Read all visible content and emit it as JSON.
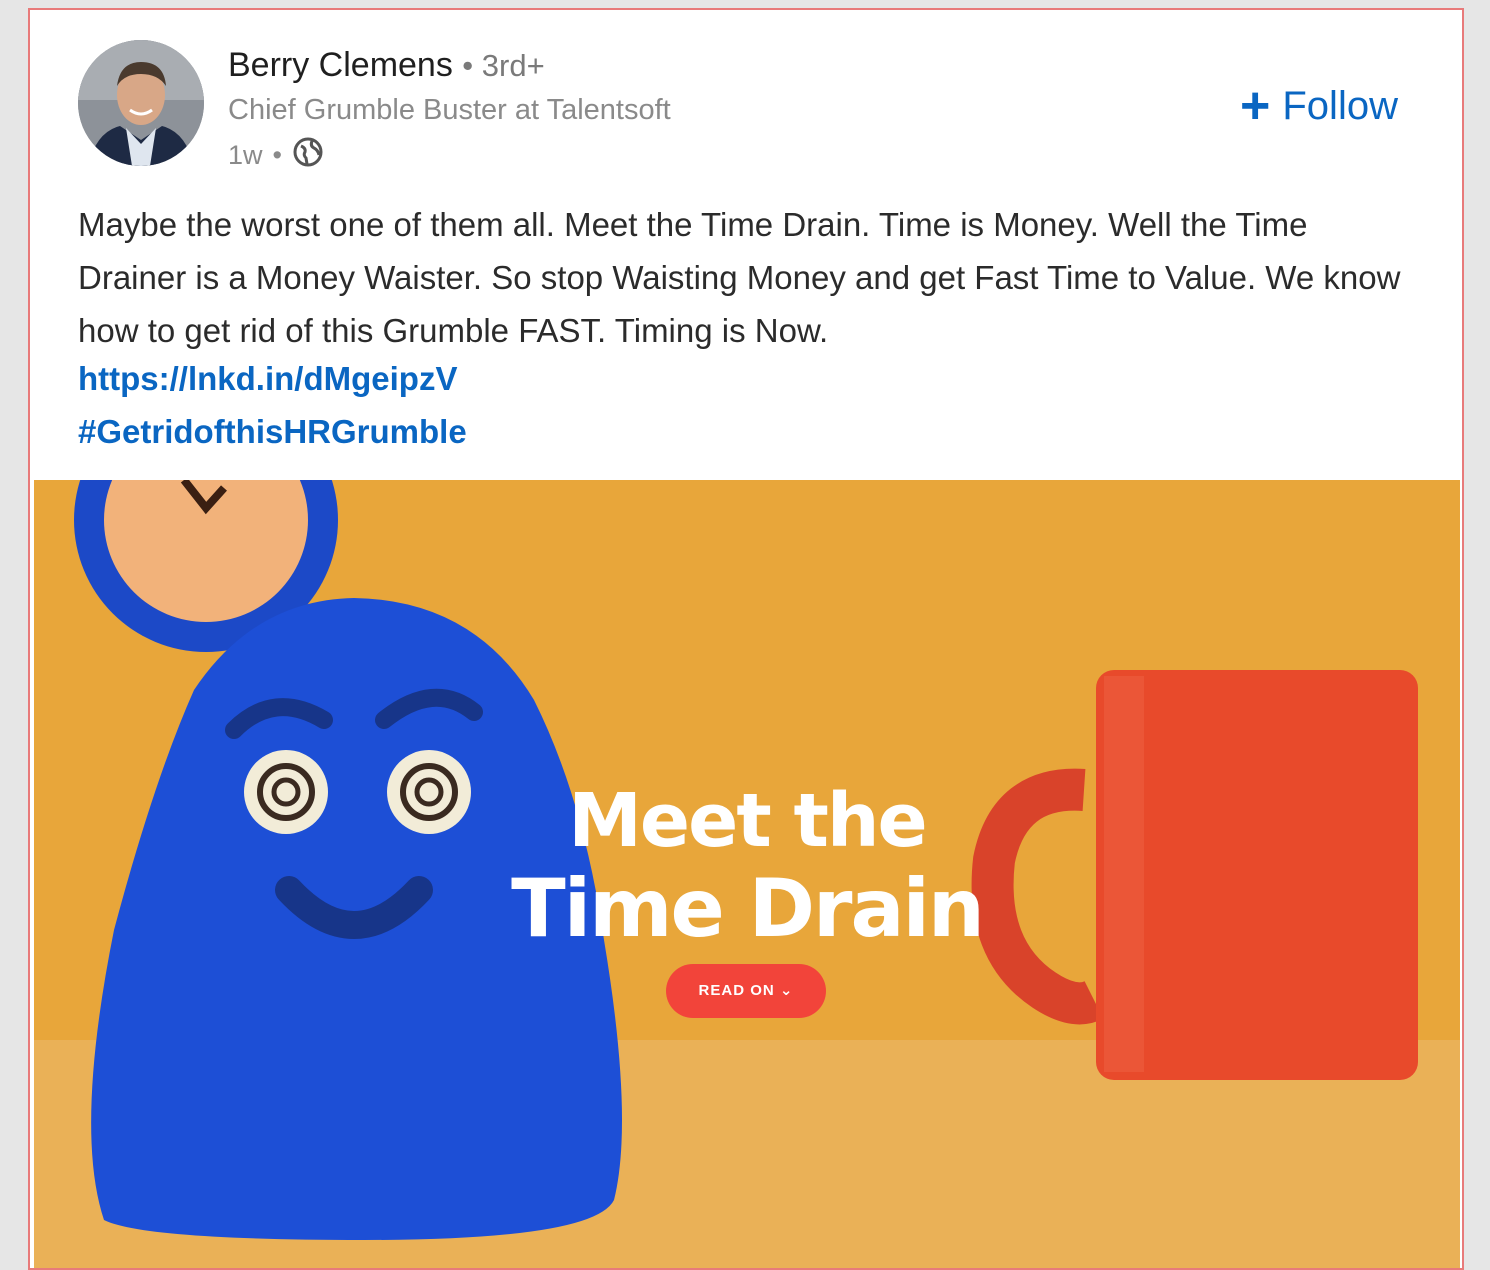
{
  "post": {
    "author_name": "Berry Clemens",
    "degree": "• 3rd+",
    "headline": "Chief Grumble Buster at Talentsoft",
    "time": "1w",
    "meta_sep": "•",
    "follow_label": "Follow",
    "body": "Maybe the worst one of them all. Meet the Time Drain. Time is Money. Well the Time Drainer is a Money Waister. So stop Waisting Money and get Fast Time to Value. We know how to get rid of this Grumble FAST. Timing is Now.",
    "link": "https://lnkd.in/dMgeipzV",
    "hashtag": "#GetridofthisHRGrumble"
  },
  "media": {
    "title_line1": "Meet the",
    "title_line2": "Time Drain",
    "cta": "READ ON"
  },
  "colors": {
    "link": "#0a66c2",
    "background": "#e9a93c",
    "character": "#1d4fd6",
    "mug": "#e84a2b",
    "cta": "#f2443a"
  },
  "icons": {
    "visibility": "globe-icon",
    "follow": "plus-icon"
  }
}
